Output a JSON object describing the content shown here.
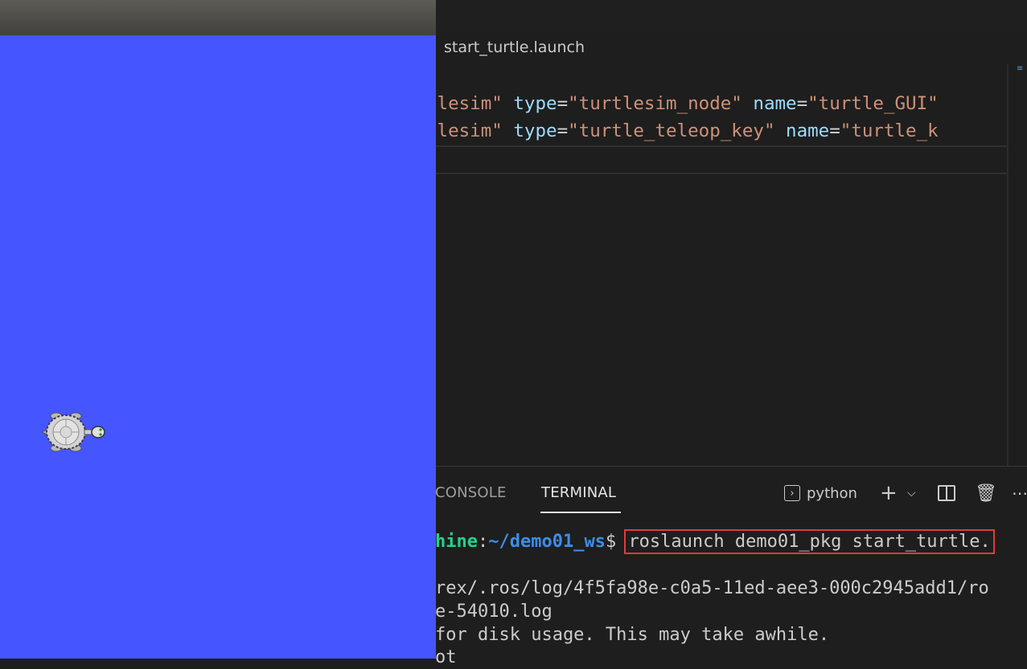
{
  "editor": {
    "active_tab": {
      "filename": "start_turtle.launch",
      "icon": "xml-file-icon"
    },
    "code_lines": [
      [
        {
          "t": "tlesim\"",
          "c": "str"
        },
        {
          "t": " ",
          "c": "eq"
        },
        {
          "t": "type",
          "c": "attr"
        },
        {
          "t": "=",
          "c": "eq"
        },
        {
          "t": "\"turtlesim_node\"",
          "c": "str"
        },
        {
          "t": " ",
          "c": "eq"
        },
        {
          "t": "name",
          "c": "attr"
        },
        {
          "t": "=",
          "c": "eq"
        },
        {
          "t": "\"turtle_GUI\"",
          "c": "str"
        }
      ],
      [
        {
          "t": "tlesim\"",
          "c": "str"
        },
        {
          "t": " ",
          "c": "eq"
        },
        {
          "t": "type",
          "c": "attr"
        },
        {
          "t": "=",
          "c": "eq"
        },
        {
          "t": "\"turtle_teleop_key\"",
          "c": "str"
        },
        {
          "t": " ",
          "c": "eq"
        },
        {
          "t": "name",
          "c": "attr"
        },
        {
          "t": "=",
          "c": "eq"
        },
        {
          "t": "\"turtle_k",
          "c": "str"
        }
      ]
    ],
    "colors": {
      "str": "#ce9178",
      "attr": "#9cdcfe",
      "eq": "#d4d4d4"
    }
  },
  "panel": {
    "tabs": {
      "console": "CONSOLE",
      "terminal": "TERMINAL"
    },
    "shell_label": "python",
    "toolbar": {
      "new_terminal_icon": "plus-icon",
      "dropdown_icon": "chevron-down-icon",
      "split_icon": "split-terminal-icon",
      "kill_icon": "trash-icon",
      "more_icon": "ellipsis-icon"
    },
    "terminal": {
      "prompt_user": "hine",
      "prompt_colon": ":",
      "prompt_path": "~/demo01_ws",
      "prompt_dollar": "$ ",
      "command": "roslaunch demo01_pkg start_turtle.",
      "lines": [
        "rex/.ros/log/4f5fa98e-c0a5-11ed-aee3-000c2945add1/ro",
        "e-54010.log",
        "for disk usage. This may take awhile.",
        "ot"
      ]
    }
  },
  "turtlesim": {
    "background_color": "#4555ff",
    "turtle_icon": "turtle-icon"
  }
}
